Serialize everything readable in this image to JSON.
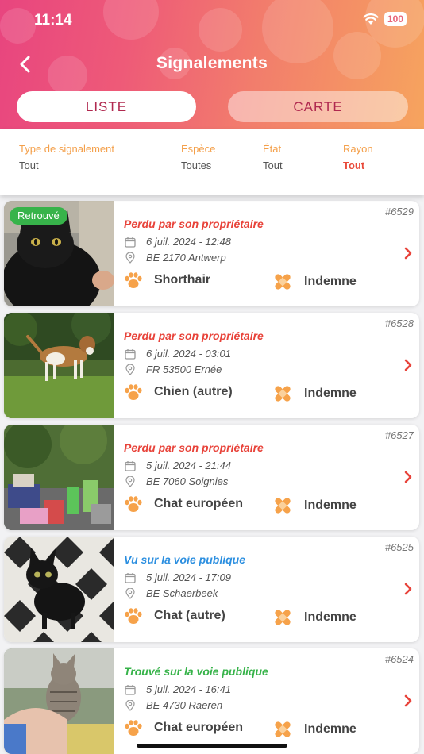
{
  "status_bar": {
    "time": "11:14",
    "battery": "100"
  },
  "header": {
    "title": "Signalements",
    "back_icon": "chevron-left-icon"
  },
  "tabs": [
    {
      "label": "LISTE",
      "active": true
    },
    {
      "label": "CARTE",
      "active": false
    }
  ],
  "filters": [
    {
      "label": "Type de signalement",
      "value": "Tout"
    },
    {
      "label": "Espèce",
      "value": "Toutes"
    },
    {
      "label": "État",
      "value": "Tout"
    },
    {
      "label": "Rayon",
      "value": "Tout"
    }
  ],
  "colors": {
    "accent_orange": "#f4a04b",
    "red": "#e8433a",
    "blue": "#2c8fe0",
    "green": "#37b34a"
  },
  "reports": [
    {
      "id": "#6529",
      "badge": "Retrouvé",
      "type": "Perdu par son propriétaire",
      "type_color": "red",
      "date": "6 juil. 2024 - 12:48",
      "location": "BE 2170 Antwerp",
      "breed": "Shorthair",
      "state": "Indemne",
      "photo": "black cat"
    },
    {
      "id": "#6528",
      "badge": "",
      "type": "Perdu par son propriétaire",
      "type_color": "red",
      "date": "6 juil. 2024 - 03:01",
      "location": "FR 53500 Ernée",
      "breed": "Chien (autre)",
      "state": "Indemne",
      "photo": "beagle dog on grass"
    },
    {
      "id": "#6527",
      "badge": "",
      "type": "Perdu par son propriétaire",
      "type_color": "red",
      "date": "5 juil. 2024 - 21:44",
      "location": "BE 7060 Soignies",
      "breed": "Chat européen",
      "state": "Indemne",
      "photo": "garden with toys"
    },
    {
      "id": "#6525",
      "badge": "",
      "type": "Vu sur la voie publique",
      "type_color": "blue",
      "date": "5 juil. 2024 - 17:09",
      "location": "BE Schaerbeek",
      "breed": "Chat (autre)",
      "state": "Indemne",
      "photo": "black kitten on rug"
    },
    {
      "id": "#6524",
      "badge": "",
      "type": "Trouvé sur la voie publique",
      "type_color": "green",
      "date": "5 juil. 2024 - 16:41",
      "location": "BE 4730 Raeren",
      "breed": "Chat européen",
      "state": "Indemne",
      "photo": "tabby kitten held"
    }
  ]
}
